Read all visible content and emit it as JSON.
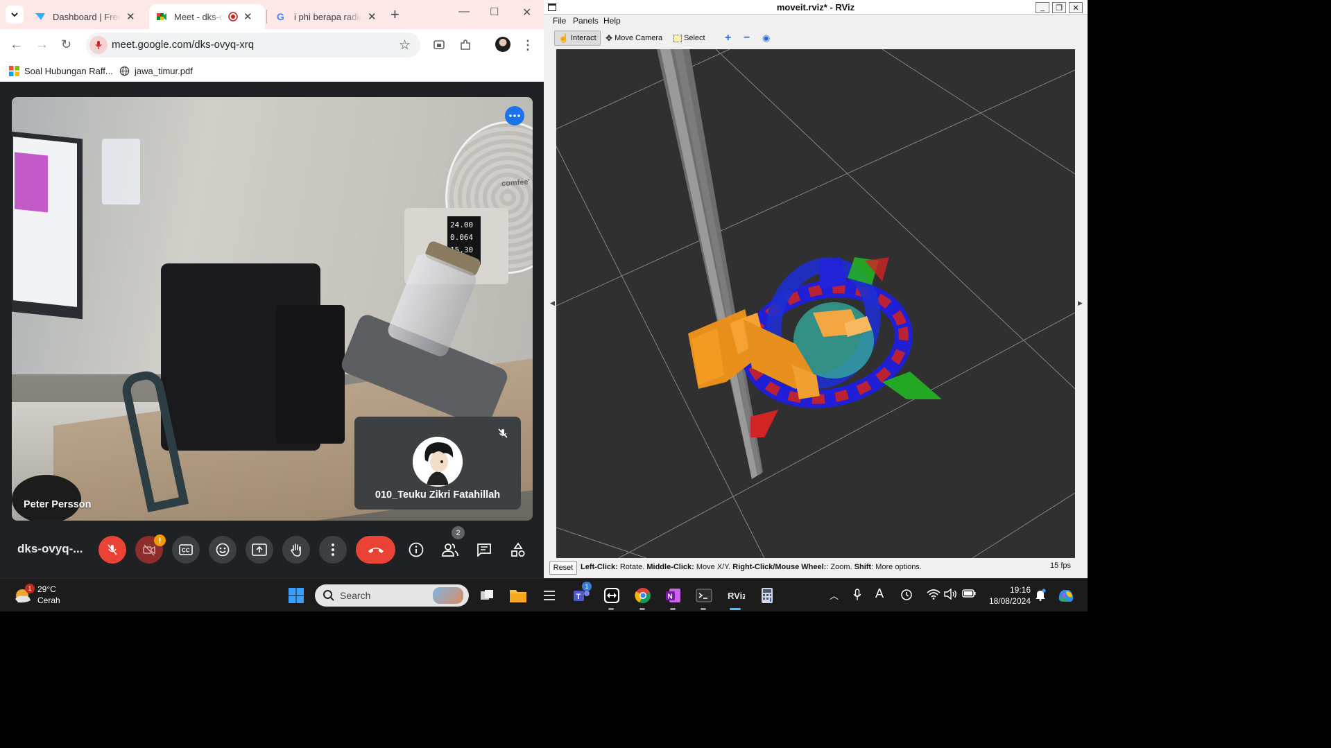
{
  "colors": {
    "chrome_tabstrip": "#fde7e7",
    "meet_bg": "#202124",
    "meet_red": "#ea4335",
    "meet_blue": "#1a73e8",
    "rviz_viewport": "#303030",
    "taskbar": "#1c1c1c"
  },
  "chrome": {
    "tabs": [
      {
        "title": "Dashboard | Freelancer",
        "icon": "freelancer-icon",
        "active": false
      },
      {
        "title": "Meet - dks-ovyq-xrq",
        "icon": "meet-icon",
        "active": true
      },
      {
        "title": "i phi berapa radian",
        "icon": "google-icon",
        "active": false
      }
    ],
    "url": "meet.google.com/dks-ovyq-xrq",
    "bookmarks": [
      {
        "label": "Soal Hubungan Raff...",
        "icon": "microsoft-icon"
      },
      {
        "label": "jawa_timur.pdf",
        "icon": "globe-icon"
      }
    ]
  },
  "meet": {
    "main_participant": "Peter Persson",
    "self_participant": "010_Teuku Zikri Fatahillah",
    "meeting_code": "dks-ovyq-...",
    "people_count": "2",
    "camera_warning": "!",
    "psu_readings": [
      "24.00",
      "0.064",
      "15.30"
    ],
    "fan_brand": "comfee'"
  },
  "rviz": {
    "title": "moveit.rviz* - RViz",
    "menu": [
      "File",
      "Panels",
      "Help"
    ],
    "tools": {
      "interact": "Interact",
      "move_camera": "Move Camera",
      "select": "Select"
    },
    "reset": "Reset",
    "help": {
      "left_key": "Left-Click:",
      "left_val": " Rotate. ",
      "middle_key": "Middle-Click:",
      "middle_val": " Move X/Y. ",
      "right_key": "Right-Click/Mouse Wheel:",
      "right_val": ": Zoom. ",
      "shift_key": "Shift",
      "shift_val": ": More options."
    },
    "fps": "15 fps"
  },
  "taskbar": {
    "weather_temp": "29°C",
    "weather_desc": "Cerah",
    "weather_badge": "1",
    "search_label": "Search",
    "teams_badge": "1",
    "time": "19:16",
    "date": "18/08/2024"
  }
}
